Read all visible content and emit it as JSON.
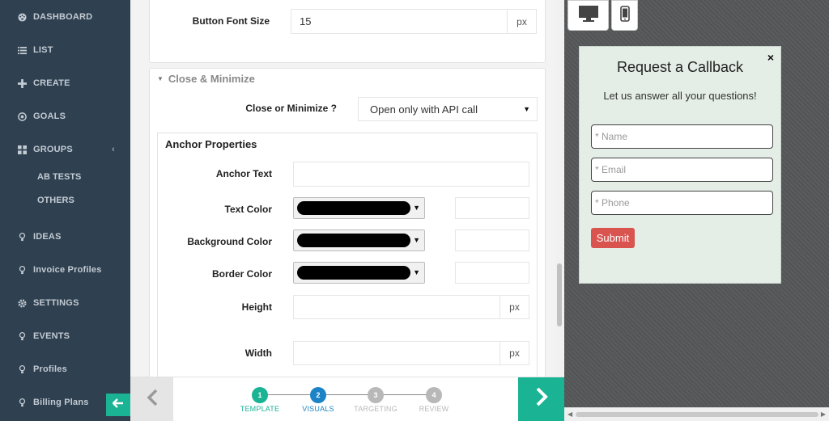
{
  "sidebar": {
    "items": [
      {
        "label": "DASHBOARD",
        "icon": "palette-icon"
      },
      {
        "label": "LIST",
        "icon": "list-icon"
      },
      {
        "label": "CREATE",
        "icon": "plus-icon"
      },
      {
        "label": "GOALS",
        "icon": "target-icon"
      },
      {
        "label": "GROUPS",
        "icon": "grid-icon"
      },
      {
        "label": "IDEAS",
        "icon": "bulb-icon"
      },
      {
        "label": "Invoice Profiles",
        "icon": "bulb-icon"
      },
      {
        "label": "SETTINGS",
        "icon": "gear-icon"
      },
      {
        "label": "EVENTS",
        "icon": "bulb-icon"
      },
      {
        "label": "Profiles",
        "icon": "bulb-icon"
      },
      {
        "label": "Billing Plans",
        "icon": "bulb-icon"
      }
    ],
    "groups_sub": [
      "AB TESTS",
      "OTHERS"
    ]
  },
  "form": {
    "button_font_size_label": "Button Font Size",
    "button_font_size_value": "15",
    "unit_px": "px",
    "close_section_title": "Close & Minimize",
    "close_or_minimize_label": "Close or Minimize ?",
    "close_or_minimize_value": "Open only with API call",
    "anchor_title": "Anchor Properties",
    "anchor_text_label": "Anchor Text",
    "anchor_text_value": "",
    "text_color_label": "Text Color",
    "background_color_label": "Background Color",
    "border_color_label": "Border Color",
    "height_label": "Height",
    "width_label": "Width",
    "swatch_color": "#000000"
  },
  "wizard": {
    "steps": [
      {
        "num": "1",
        "label": "TEMPLATE",
        "color": "#1ab394"
      },
      {
        "num": "2",
        "label": "VISUALS",
        "color": "#1c84c6"
      },
      {
        "num": "3",
        "label": "TARGETING",
        "color": "#b8b8b8"
      },
      {
        "num": "4",
        "label": "REVIEW",
        "color": "#b8b8b8"
      }
    ]
  },
  "preview": {
    "title": "Request a Callback",
    "subtitle": "Let us answer all your questions!",
    "close_glyph": "×",
    "fields": [
      "* Name",
      "* Email",
      "* Phone"
    ],
    "submit_label": "Submit"
  }
}
